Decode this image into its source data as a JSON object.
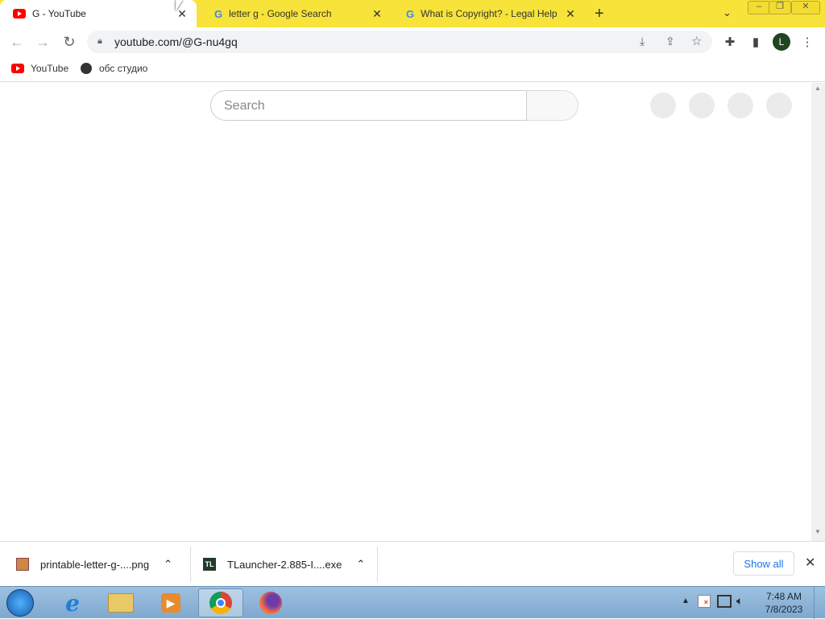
{
  "browser": {
    "tabs": [
      {
        "title": "G - YouTube",
        "active": true
      },
      {
        "title": "letter g - Google Search",
        "active": false
      },
      {
        "title": "What is Copyright? - Legal Help",
        "active": false
      }
    ],
    "new_tab_symbol": "+",
    "url": "youtube.com/@G-nu4gq",
    "avatar_letter": "L",
    "accent_color": "#f7e33a"
  },
  "bookmarks": [
    {
      "label": "YouTube"
    },
    {
      "label": "обс студио"
    }
  ],
  "youtube": {
    "search_placeholder": "Search"
  },
  "downloads": {
    "items": [
      {
        "name": "printable-letter-g-....png"
      },
      {
        "name": "TLauncher-2.885-I....exe"
      }
    ],
    "show_all_label": "Show all"
  },
  "taskbar": {
    "time": "7:48 AM",
    "date": "7/8/2023"
  }
}
